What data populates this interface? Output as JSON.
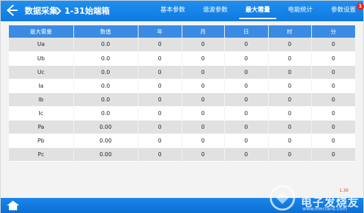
{
  "header": {
    "title": "数据采集",
    "subtitle": "1-31始端箱",
    "tabs": [
      {
        "label": "基本参数",
        "active": false
      },
      {
        "label": "谐波参数",
        "active": false
      },
      {
        "label": "最大需量",
        "active": true
      },
      {
        "label": "电能统计",
        "active": false
      },
      {
        "label": "参数设置",
        "active": false,
        "badge": "1"
      }
    ]
  },
  "table": {
    "columns": [
      "最大需量",
      "数值",
      "年",
      "月",
      "日",
      "时",
      "分"
    ],
    "rows": [
      [
        "Ua",
        "0.0",
        "0",
        "0",
        "0",
        "0",
        "0"
      ],
      [
        "Ub",
        "0.0",
        "0",
        "0",
        "0",
        "0",
        "0"
      ],
      [
        "Uc",
        "0.0",
        "0",
        "0",
        "0",
        "0",
        "0"
      ],
      [
        "Ia",
        "0.0",
        "0",
        "0",
        "0",
        "0",
        "0"
      ],
      [
        "Ib",
        "0.0",
        "0",
        "0",
        "0",
        "0",
        "0"
      ],
      [
        "Ic",
        "0.0",
        "0",
        "0",
        "0",
        "0",
        "0"
      ],
      [
        "Pa",
        "0.00",
        "0",
        "0",
        "0",
        "0",
        "0"
      ],
      [
        "Pb",
        "0.00",
        "0",
        "0",
        "0",
        "0",
        "0"
      ],
      [
        "Pc",
        "0.00",
        "0",
        "0",
        "0",
        "0",
        "0"
      ]
    ]
  },
  "footer": {
    "version": "1.30",
    "watermark": "电子发烧友",
    "watermark_url": "www.elecfans.com"
  },
  "colors": {
    "header_blue": "#1183e8",
    "table_header": "#3a8be3",
    "row_grey": "#e1e1e1",
    "badge_red": "#e5262b"
  }
}
